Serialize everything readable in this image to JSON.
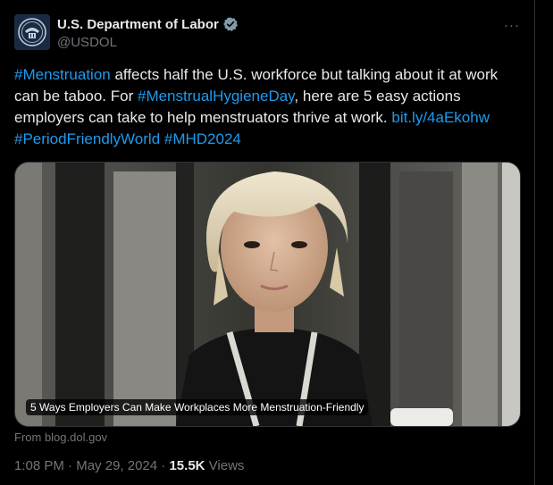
{
  "account": {
    "name": "U.S. Department of Labor",
    "handle": "@USDOL",
    "avatar_icon": "dol-seal-icon",
    "verified_icon": "verified-badge-icon",
    "verified_color": "#829aab"
  },
  "more_label": "···",
  "tweet": {
    "seg1": "#Menstruation",
    "seg2": " affects half the U.S. workforce but talking about it at work can be taboo. For ",
    "seg3": "#MenstrualHygieneDay",
    "seg4": ", here are 5 easy actions employers can take to help menstruators thrive at work. ",
    "seg5": "bit.ly/4aEkohw",
    "seg6": "#PeriodFriendlyWorld",
    "seg7": " ",
    "seg8": "#MHD2024"
  },
  "card": {
    "caption": "5 Ways Employers Can Make Workplaces More Menstruation-Friendly",
    "from": "From blog.dol.gov"
  },
  "meta": {
    "time": "1:08 PM",
    "sep1": " · ",
    "date": "May 29, 2024",
    "sep2": " · ",
    "views_count": "15.5K",
    "views_label": " Views"
  },
  "colors": {
    "link": "#1d9bf0",
    "muted": "#71767b",
    "text": "#e7e9ea",
    "background": "#000000"
  }
}
